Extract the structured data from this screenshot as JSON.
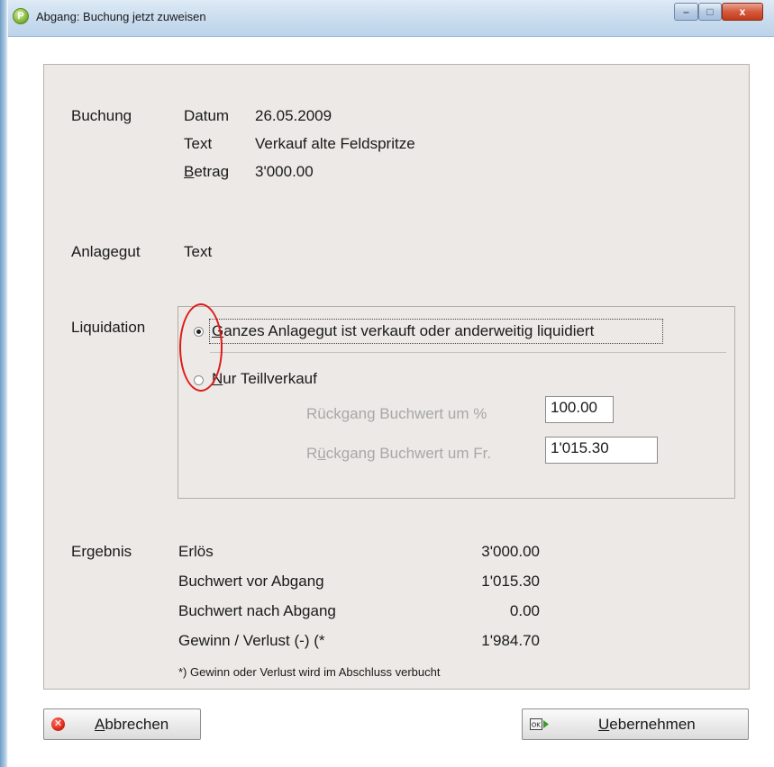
{
  "window": {
    "title": "Abgang: Buchung jetzt zuweisen",
    "app_icon_glyph": "P",
    "minimize": "–",
    "maximize": "□",
    "close": "x"
  },
  "booking": {
    "section_label": "Buchung",
    "date_label": "Datum",
    "date_value": "26.05.2009",
    "text_label": "Text",
    "text_value": "Verkauf alte Feldspritze",
    "amount_label_first": "B",
    "amount_label_rest": "etrag",
    "amount_value": "3'000.00"
  },
  "asset": {
    "section_label": "Anlagegut",
    "value": "Text"
  },
  "liquidation": {
    "section_label": "Liquidation",
    "option_full_first": "G",
    "option_full_rest": "anzes Anlagegut ist verkauft oder anderweitig liquidiert",
    "option_full_selected": true,
    "option_partial_first": "N",
    "option_partial_rest": "ur Teillverkauf",
    "option_partial_selected": false,
    "decline_percent_label": "Rückgang Buchwert um %",
    "decline_percent_value": "100.00",
    "decline_amount_label_a": "R",
    "decline_amount_label_u": "ü",
    "decline_amount_label_b": "ckgang Buchwert um Fr.",
    "decline_amount_value": "1'015.30"
  },
  "result": {
    "section_label": "Ergebnis",
    "rows": [
      {
        "label": "Erlös",
        "value": "3'000.00"
      },
      {
        "label": "Buchwert vor Abgang",
        "value": "1'015.30"
      },
      {
        "label": "Buchwert nach Abgang",
        "value": "0.00"
      },
      {
        "label": "Gewinn / Verlust (-) (*",
        "value": "1'984.70"
      }
    ],
    "footnote": "*) Gewinn oder Verlust wird im Abschluss verbucht"
  },
  "buttons": {
    "cancel_first": "A",
    "cancel_rest": "bbrechen",
    "ok_icon_label": "OK",
    "apply_first": "U",
    "apply_rest": "ebernehmen"
  },
  "colors": {
    "annotation_circle": "#e01a1a",
    "panel_bg": "#ece9e6"
  }
}
